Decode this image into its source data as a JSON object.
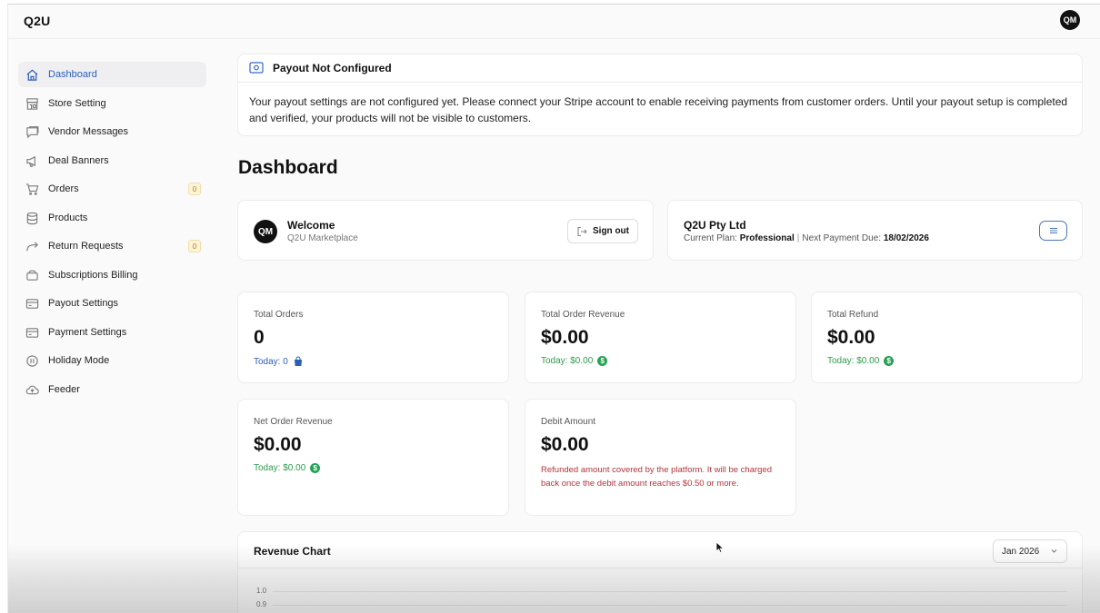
{
  "app": {
    "brand": "Q2U",
    "user_initials": "QM"
  },
  "sidebar": {
    "items": [
      {
        "label": "Dashboard",
        "icon": "home-icon",
        "active": true
      },
      {
        "label": "Store Setting",
        "icon": "store-icon"
      },
      {
        "label": "Vendor Messages",
        "icon": "message-icon"
      },
      {
        "label": "Deal Banners",
        "icon": "megaphone-icon"
      },
      {
        "label": "Orders",
        "icon": "cart-icon",
        "badge": "0"
      },
      {
        "label": "Products",
        "icon": "database-icon"
      },
      {
        "label": "Return Requests",
        "icon": "return-arrow-icon",
        "badge": "0"
      },
      {
        "label": "Subscriptions Billing",
        "icon": "wallet-icon"
      },
      {
        "label": "Payout Settings",
        "icon": "card-icon"
      },
      {
        "label": "Payment Settings",
        "icon": "card-icon"
      },
      {
        "label": "Holiday Mode",
        "icon": "pause-icon"
      },
      {
        "label": "Feeder",
        "icon": "cloud-upload-icon"
      }
    ]
  },
  "alert": {
    "title": "Payout Not Configured",
    "body": "Your payout settings are not configured yet. Please connect your Stripe account to enable receiving payments from customer orders. Until your payout setup is completed and verified, your products will not be visible to customers."
  },
  "page_title": "Dashboard",
  "welcome": {
    "initials": "QM",
    "title": "Welcome",
    "subtitle": "Q2U Marketplace",
    "signout_label": "Sign out"
  },
  "company": {
    "name": "Q2U Pty Ltd",
    "plan_label": "Current Plan:",
    "plan_value": "Professional",
    "due_label": "Next Payment Due:",
    "due_value": "18/02/2026"
  },
  "stats": {
    "total_orders": {
      "label": "Total Orders",
      "value": "0",
      "today": "Today: 0"
    },
    "total_revenue": {
      "label": "Total Order Revenue",
      "value": "$0.00",
      "today": "Today: $0.00"
    },
    "total_refund": {
      "label": "Total Refund",
      "value": "$0.00",
      "today": "Today: $0.00"
    },
    "net_revenue": {
      "label": "Net Order Revenue",
      "value": "$0.00",
      "today": "Today: $0.00"
    },
    "debit": {
      "label": "Debit Amount",
      "value": "$0.00",
      "note": "Refunded amount covered by the platform. It will be charged back once the debit amount reaches $0.50 or more."
    }
  },
  "revenue_chart": {
    "title": "Revenue Chart",
    "month": "Jan 2026",
    "ticks": [
      "1.0",
      "0.9"
    ]
  },
  "colors": {
    "accent": "#2b5fb8",
    "success": "#23a455",
    "danger": "#b4353c",
    "badge_bg": "#fdf3d8"
  }
}
